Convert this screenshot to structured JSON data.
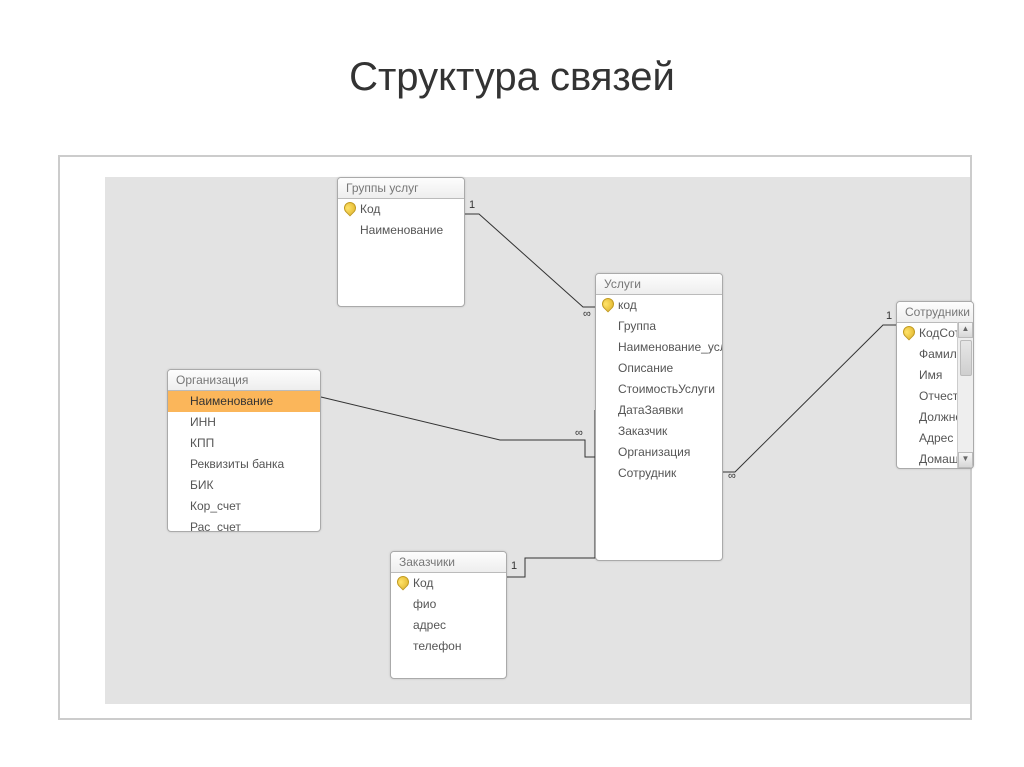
{
  "title": "Структура связей",
  "entities": {
    "groups": {
      "title": "Группы услуг",
      "fields": [
        "Код",
        "Наименование"
      ],
      "pk_index": 0,
      "selected_index": -1
    },
    "org": {
      "title": "Организация",
      "fields": [
        "Наименование",
        "ИНН",
        "КПП",
        "Реквизиты банка",
        "БИК",
        "Кор_счет",
        "Рас_счет"
      ],
      "pk_index": -1,
      "selected_index": 0
    },
    "services": {
      "title": "Услуги",
      "fields": [
        "код",
        "Группа",
        "Наименование_услу",
        "Описание",
        "СтоимостьУслуги",
        "ДатаЗаявки",
        "Заказчик",
        "Организация",
        "Сотрудник"
      ],
      "pk_index": 0,
      "selected_index": -1
    },
    "customers": {
      "title": "Заказчики",
      "fields": [
        "Код",
        "фио",
        "адрес",
        "телефон"
      ],
      "pk_index": 0,
      "selected_index": -1
    },
    "employees": {
      "title": "Сотрудники",
      "fields": [
        "КодСотруд",
        "Фамилия",
        "Имя",
        "Отчество",
        "Должность",
        "Адрес",
        "Домашний"
      ],
      "pk_index": 0,
      "selected_index": -1
    }
  },
  "relationships": {
    "groups_services": {
      "from": "Группы услуг.Код",
      "to": "Услуги.Группа",
      "from_card": "1",
      "to_card": "∞"
    },
    "org_services": {
      "from": "Организация.Наименование",
      "to": "Услуги.Организация",
      "from_card": "",
      "to_card": "∞"
    },
    "customers_services": {
      "from": "Заказчики.Код",
      "to": "Услуги.Заказчик",
      "from_card": "1",
      "to_card": ""
    },
    "employees_services": {
      "from": "Сотрудники.КодСотруд",
      "to": "Услуги.Сотрудник",
      "from_card": "1",
      "to_card": "∞"
    }
  },
  "labels": {
    "one": "1",
    "many": "∞",
    "scroll_up": "▲",
    "scroll_down": "▼"
  }
}
